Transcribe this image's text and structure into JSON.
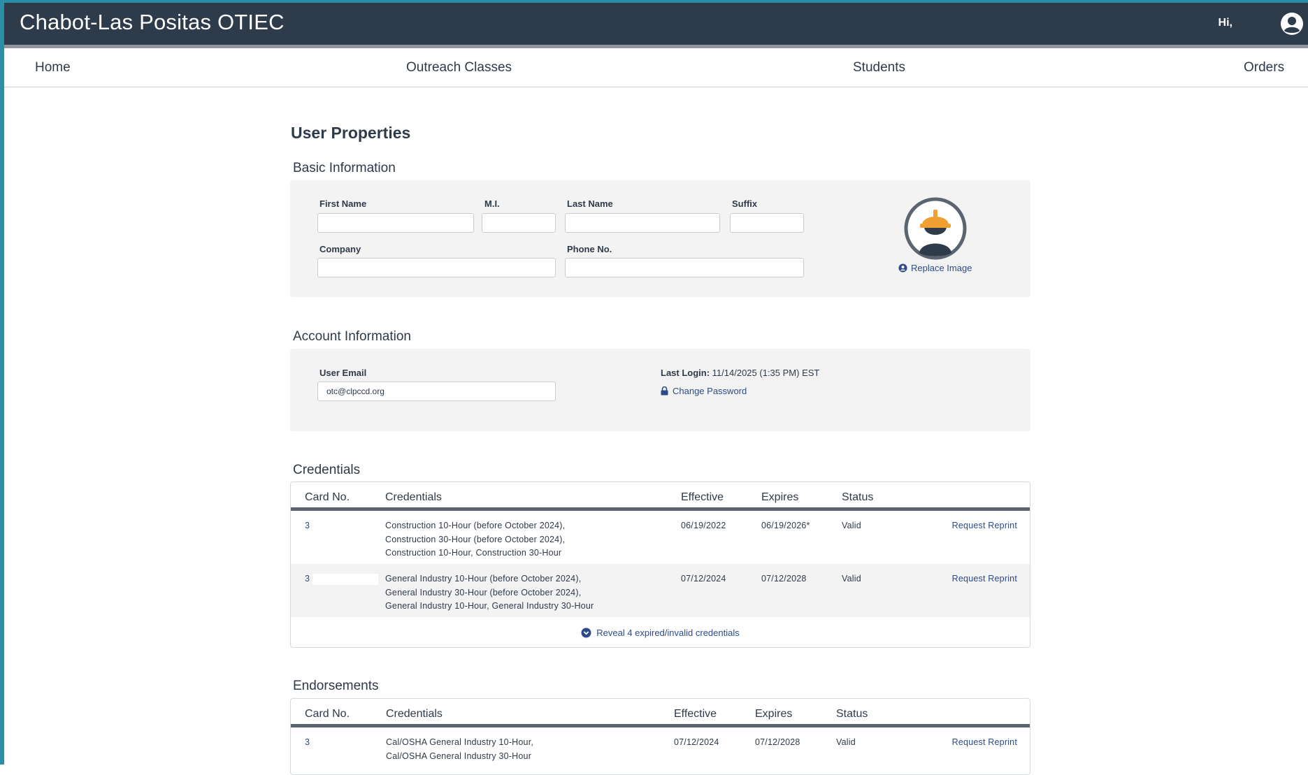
{
  "app": {
    "title": "Chabot-Las Positas OTIEC",
    "greeting": "Hi,"
  },
  "nav": {
    "items": [
      "Home",
      "Outreach Classes",
      "Students",
      "Orders"
    ]
  },
  "page": {
    "title": "User Properties"
  },
  "basic_info": {
    "section_title": "Basic Information",
    "first_name": {
      "label": "First Name",
      "value": ""
    },
    "mi": {
      "label": "M.I.",
      "value": ""
    },
    "last_name": {
      "label": "Last Name",
      "value": ""
    },
    "suffix": {
      "label": "Suffix",
      "value": ""
    },
    "company": {
      "label": "Company",
      "value": ""
    },
    "phone": {
      "label": "Phone No.",
      "value": ""
    },
    "replace_image": "Replace Image"
  },
  "account_info": {
    "section_title": "Account Information",
    "email": {
      "label": "User Email",
      "value": "otc@clpccd.org"
    },
    "last_login_label": "Last Login:",
    "last_login_value": "11/14/2025 (1:35 PM) EST",
    "change_password": "Change Password"
  },
  "credentials": {
    "section_title": "Credentials",
    "columns": [
      "Card No.",
      "Credentials",
      "Effective",
      "Expires",
      "Status"
    ],
    "rows": [
      {
        "card_no": "3",
        "credentials": [
          "Construction 10-Hour (before October 2024),",
          "Construction 30-Hour (before October 2024),",
          "Construction 10-Hour, Construction 30-Hour"
        ],
        "effective": "06/19/2022",
        "expires": "06/19/2026*",
        "status": "Valid",
        "action": "Request Reprint"
      },
      {
        "card_no": "3",
        "credentials": [
          "General Industry 10-Hour (before October 2024),",
          "General Industry 30-Hour (before October 2024),",
          "General Industry 10-Hour, General Industry 30-Hour"
        ],
        "effective": "07/12/2024",
        "expires": "07/12/2028",
        "status": "Valid",
        "action": "Request Reprint"
      }
    ],
    "reveal_label": "Reveal 4 expired/invalid credentials"
  },
  "endorsements": {
    "section_title": "Endorsements",
    "columns": [
      "Card No.",
      "Credentials",
      "Effective",
      "Expires",
      "Status"
    ],
    "rows": [
      {
        "card_no": "3",
        "credentials": [
          "Cal/OSHA General Industry 10-Hour,",
          "Cal/OSHA General Industry 30-Hour"
        ],
        "effective": "07/12/2024",
        "expires": "07/12/2028",
        "status": "Valid",
        "action": "Request Reprint"
      }
    ]
  },
  "colors": {
    "header_bg": "#2e3b4b",
    "accent_border": "#2a8fa6",
    "link": "#2c4a8a",
    "helmet": "#f0a030",
    "panel_bg": "#f3f3f3"
  },
  "icons": [
    "user-circle-icon",
    "worker-avatar-icon",
    "user-circle-small-icon",
    "lock-icon",
    "chevron-down-circle-icon"
  ]
}
